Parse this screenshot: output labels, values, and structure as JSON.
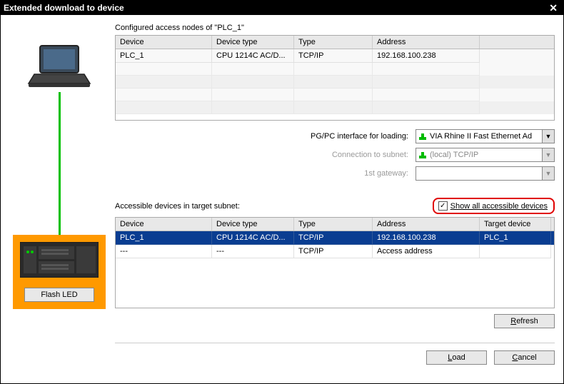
{
  "title": "Extended download to device",
  "configured_label": "Configured access nodes of \"PLC_1\"",
  "table1": {
    "headers": {
      "device": "Device",
      "dtype": "Device type",
      "type": "Type",
      "addr": "Address"
    },
    "rows": [
      {
        "device": "PLC_1",
        "dtype": "CPU 1214C AC/D...",
        "type": "TCP/IP",
        "addr": "192.168.100.238"
      }
    ]
  },
  "form": {
    "interface_label": "PG/PC interface for loading:",
    "interface_value": "VIA Rhine II Fast Ethernet Ad",
    "subnet_label": "Connection to subnet:",
    "subnet_value": "(local) TCP/IP",
    "gateway_label": "1st gateway:",
    "gateway_value": ""
  },
  "accessible_label": "Accessible devices in target subnet:",
  "show_all_label": "Show all accessible devices",
  "show_all_checked": true,
  "table2": {
    "headers": {
      "device": "Device",
      "dtype": "Device type",
      "type": "Type",
      "addr": "Address",
      "target": "Target device"
    },
    "rows": [
      {
        "device": "PLC_1",
        "dtype": "CPU 1214C AC/D...",
        "type": "TCP/IP",
        "addr": "192.168.100.238",
        "target": "PLC_1",
        "selected": true
      },
      {
        "device": "---",
        "dtype": "---",
        "type": "TCP/IP",
        "addr": "Access address",
        "target": "",
        "selected": false
      }
    ]
  },
  "buttons": {
    "flash": "Flash LED",
    "refresh": "Refresh",
    "load": "Load",
    "cancel": "Cancel"
  }
}
